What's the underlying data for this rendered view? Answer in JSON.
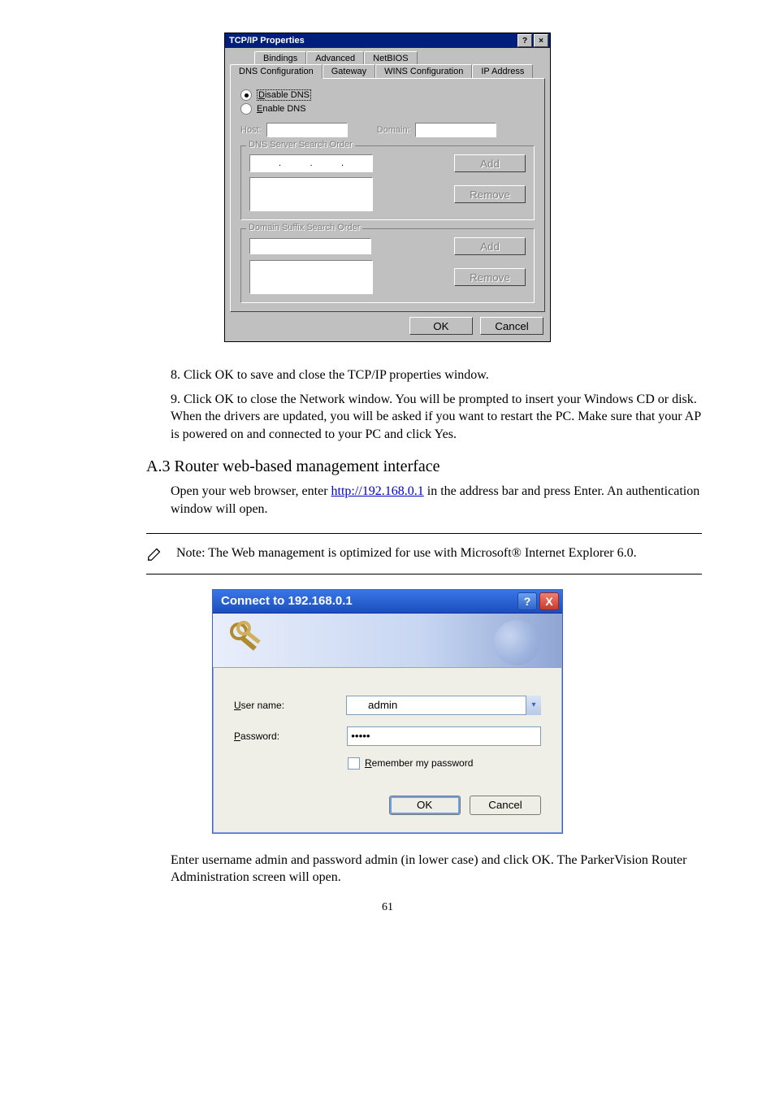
{
  "tcpip": {
    "title": "TCP/IP Properties",
    "tabs_back": [
      "Bindings",
      "Advanced",
      "NetBIOS"
    ],
    "tabs_front": [
      "DNS Configuration",
      "Gateway",
      "WINS Configuration",
      "IP Address"
    ],
    "radio_disable": "Disable DNS",
    "radio_enable": "Enable DNS",
    "host_label": "Host:",
    "domain_label": "Domain:",
    "group1": "DNS Server Search Order",
    "group2": "Domain Suffix Search Order",
    "add": "Add",
    "remove": "Remove",
    "ok": "OK",
    "cancel": "Cancel"
  },
  "step8": "8. Click OK to save and close the TCP/IP properties window.",
  "step9": "9. Click OK to close the Network window. You will be prompted to insert your Windows CD or disk. When the drivers are updated, you will be asked if you want to restart the PC. Make sure that your AP is powered on and connected to your PC and click Yes.",
  "heading_a": "A.3 Router web-based management interface",
  "para_a1": "Open your web browser, enter ",
  "router_url": "http://192.168.0.1",
  "para_a1b": " in the address bar and press Enter. An authentication window will open.",
  "note_text": "Note: The Web management is optimized for use with Microsoft® Internet Explorer 6.0.",
  "xp": {
    "title": "Connect to 192.168.0.1",
    "username_label_pre": "U",
    "username_label": "ser name:",
    "password_label_pre": "P",
    "password_label": "assword:",
    "username_value": "admin",
    "password_value": "•••••",
    "remember_pre": "R",
    "remember": "emember my password",
    "ok": "OK",
    "cancel": "Cancel"
  },
  "para_end": "Enter username admin and password admin (in lower case) and click OK. The ParkerVision Router Administration screen will open.",
  "page_number": "61"
}
